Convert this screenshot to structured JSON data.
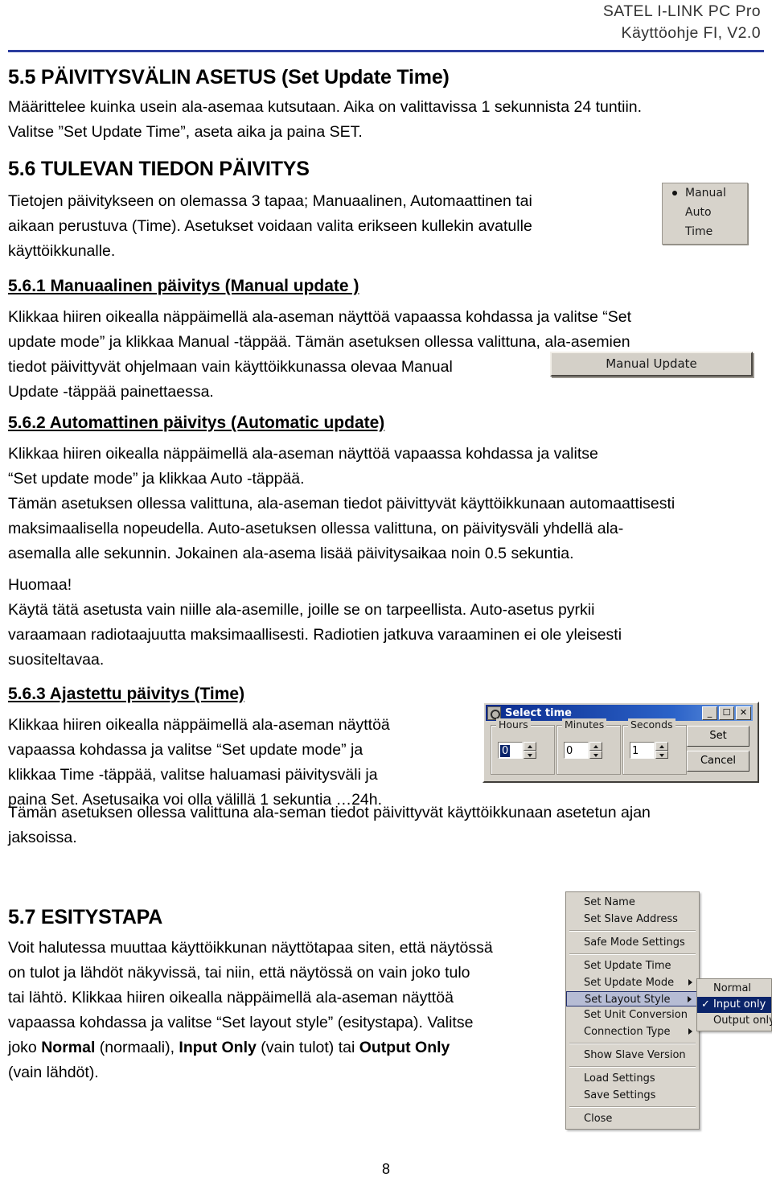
{
  "header": {
    "line1": "SATEL I-LINK PC Pro",
    "line2": "Käyttöohje FI, V2.0",
    "rule_color": "#2b3c9e"
  },
  "sections": {
    "s55": {
      "heading": "5.5 PÄIVITYSVÄLIN ASETUS (Set Update Time)",
      "p1_l1": "Määrittelee kuinka usein ala-asemaa kutsutaan.  Aika on valittavissa 1 sekunnista  24 tuntiin.",
      "p1_l2": "Valitse ”Set Update Time”, aseta aika ja paina SET."
    },
    "s56": {
      "heading": "5.6 TULEVAN TIEDON PÄIVITYS",
      "p1_l1": "Tietojen päivitykseen on olemassa 3 tapaa; Manuaalinen,  Automaattinen tai",
      "p1_l2": "aikaan perustuva (Time).  Asetukset voidaan valita erikseen kullekin avatulle",
      "p1_l3": "käyttöikkunalle."
    },
    "s561": {
      "heading": "5.6.1  Manuaalinen päivitys (Manual update  )",
      "p1_l1": "Klikkaa hiiren oikealla näppäimellä ala-aseman näyttöä vapaassa kohdassa ja valitse  “Set",
      "p1_l2": "update mode” ja klikkaa Manual -täppää.  Tämän asetuksen ollessa valittuna, ala-asemien",
      "p1_l3": "tiedot päivittyvät ohjelmaan vain käyttöikkunassa olevaa Manual",
      "p1_l4": "Update -täppää painettaessa."
    },
    "s562": {
      "heading": "5.6.2  Automattinen päivitys (Automatic update)",
      "p1_l1": "Klikkaa hiiren oikealla näppäimellä ala-aseman näyttöä vapaassa kohdassa ja valitse",
      "p1_l2": "“Set update mode” ja klikkaa Auto -täppää.",
      "p1_l3": "Tämän asetuksen ollessa valittuna, ala-aseman tiedot päivittyvät käyttöikkunaan automaattisesti",
      "p1_l4": "maksimaalisella nopeudella.  Auto-asetuksen ollessa valittuna, on päivitysväli yhdellä ala-",
      "p1_l5": "asemalla alle sekunnin. Jokainen ala-asema lisää päivitysaikaa noin 0.5 sekuntia.",
      "note_title": "Huomaa!",
      "note_l1": "Käytä tätä asetusta vain niille ala-asemille, joille se on tarpeellista.  Auto-asetus pyrkii",
      "note_l2": "varaamaan radiotaajuutta maksimaallisesti. Radiotien jatkuva varaaminen ei ole yleisesti",
      "note_l3": "suositeltavaa."
    },
    "s563": {
      "heading": "5.6.3  Ajastettu päivitys (Time)",
      "p1_l1": "Klikkaa hiiren oikealla näppäimellä ala-aseman näyttöä",
      "p1_l2": "vapaassa kohdassa ja valitse  “Set update mode” ja",
      "p1_l3": "klikkaa Time -täppää, valitse haluamasi päivitysväli ja",
      "p1_l4": "paina Set. Asetusaika voi olla välillä 1 sekuntia …24h.",
      "p1_l5": "Tämän asetuksen ollessa valittuna ala-seman tiedot päivittyvät käyttöikkunaan asetetun ajan",
      "p1_l6": "jaksoissa."
    },
    "s57": {
      "heading": "5.7 ESITYSTAPA",
      "p1_l1": "Voit halutessa muuttaa käyttöikkunan näyttötapaa siten, että näytössä",
      "p1_l2": "on tulot ja lähdöt näkyvissä, tai niin, että näytössä on vain joko tulo",
      "p1_l3": "tai lähtö. Klikkaa hiiren oikealla näppäimellä ala-aseman näyttöä",
      "p1_l4": "vapaassa kohdassa ja valitse “Set layout style” (esitystapa).  Valitse",
      "p1_l5_a": "joko ",
      "p1_l5_b": "Normal",
      "p1_l5_c": " (normaali), ",
      "p1_l5_d": "Input Only",
      "p1_l5_e": " (vain tulot) tai ",
      "p1_l5_f": "Output Only",
      "p1_l6": "(vain lähdöt)."
    }
  },
  "update_mode_menu": {
    "items": [
      {
        "label": "Manual",
        "selected": true
      },
      {
        "label": "Auto",
        "selected": false
      },
      {
        "label": "Time",
        "selected": false
      }
    ]
  },
  "manual_update_button": {
    "label": "Manual Update"
  },
  "select_time_dialog": {
    "title": "Select time",
    "caption_buttons": [
      "_",
      "☐",
      "✕"
    ],
    "groups": [
      {
        "label": "Hours",
        "value": "0",
        "selected": true
      },
      {
        "label": "Minutes",
        "value": "0",
        "selected": false
      },
      {
        "label": "Seconds",
        "value": "1",
        "selected": false
      }
    ],
    "set_label": "Set",
    "cancel_label": "Cancel"
  },
  "context_menu": {
    "items": [
      {
        "label": "Set Name",
        "arrow": false,
        "highlighted": false
      },
      {
        "label": "Set Slave Address",
        "arrow": false,
        "highlighted": false
      },
      {
        "separator": true
      },
      {
        "label": "Safe Mode Settings",
        "arrow": false,
        "highlighted": false
      },
      {
        "separator": true
      },
      {
        "label": "Set Update Time",
        "arrow": false,
        "highlighted": false
      },
      {
        "label": "Set Update Mode",
        "arrow": true,
        "highlighted": false
      },
      {
        "label": "Set Layout Style",
        "arrow": true,
        "highlighted": true
      },
      {
        "label": "Set Unit Conversion",
        "arrow": false,
        "highlighted": false
      },
      {
        "label": "Connection Type",
        "arrow": true,
        "highlighted": false
      },
      {
        "separator": true
      },
      {
        "label": "Show Slave Version",
        "arrow": false,
        "highlighted": false
      },
      {
        "separator": true
      },
      {
        "label": "Load Settings",
        "arrow": false,
        "highlighted": false
      },
      {
        "label": "Save Settings",
        "arrow": false,
        "highlighted": false
      },
      {
        "separator": true
      },
      {
        "label": "Close",
        "arrow": false,
        "highlighted": false
      }
    ]
  },
  "layout_submenu": {
    "items": [
      {
        "label": "Normal",
        "checked": false,
        "selected": false
      },
      {
        "label": "Input only",
        "checked": true,
        "selected": true
      },
      {
        "label": "Output only",
        "checked": false,
        "selected": false
      }
    ],
    "check_glyph": "✓"
  },
  "footer": {
    "page_number": "8"
  }
}
